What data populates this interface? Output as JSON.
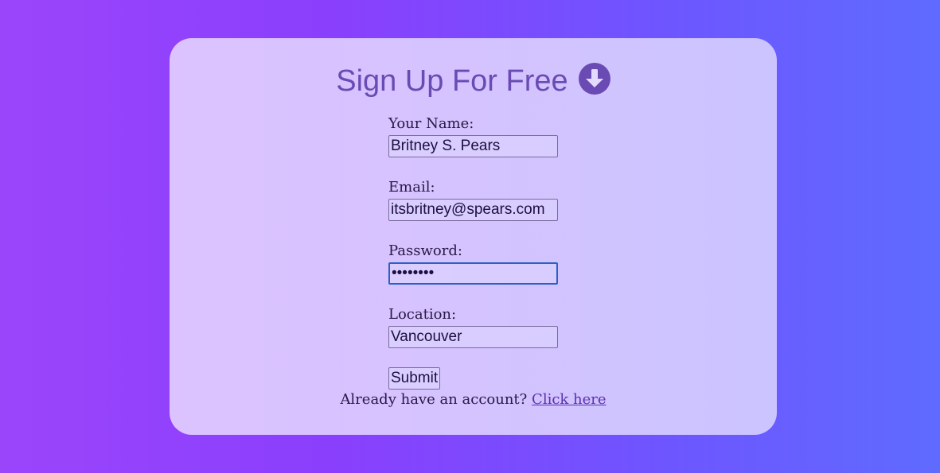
{
  "header": {
    "title": "Sign Up For Free",
    "icon": "arrow-down-circle-icon"
  },
  "form": {
    "name": {
      "label": "Your Name:",
      "value": "Britney S. Pears"
    },
    "email": {
      "label": "Email:",
      "value": "itsbritney@spears.com"
    },
    "password": {
      "label": "Password:",
      "value": "••••••••"
    },
    "location": {
      "label": "Location:",
      "value": "Vancouver"
    },
    "submit_label": "Submit"
  },
  "footer": {
    "prompt": "Already have an account?",
    "link_label": "Click here"
  },
  "colors": {
    "accent": "#6a4bb3",
    "link": "#5a2fb0",
    "focus_ring": "#2d5fc4"
  }
}
